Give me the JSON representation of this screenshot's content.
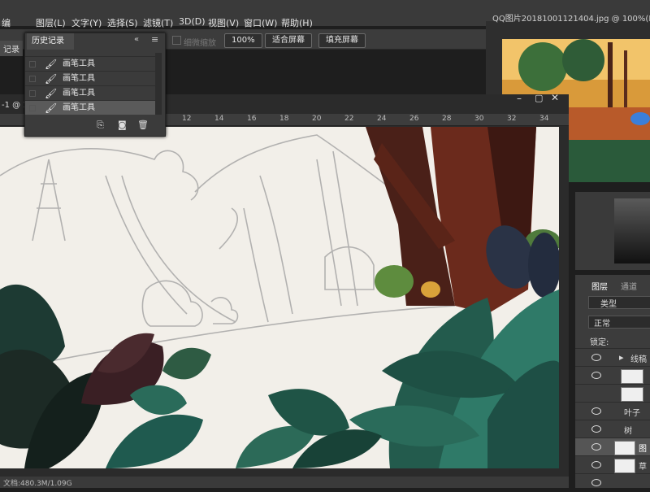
{
  "menubar": {
    "items": [
      "图层(L)",
      "文字(Y)",
      "选择(S)",
      "滤镜(T)",
      "3D(D)",
      "视图(V)",
      "窗口(W)",
      "帮助(H)"
    ],
    "partial_left": "编"
  },
  "options_bar": {
    "scrubby_zoom": "细微缩放",
    "zoom_value": "100%",
    "fit_screen": "适合屏幕",
    "fill_screen": "填充屏幕",
    "left_partial": "记录"
  },
  "history_panel": {
    "tab_label": "历史记录",
    "items": [
      "画笔工具",
      "画笔工具",
      "画笔工具",
      "画笔工具"
    ],
    "selected_index": 3
  },
  "document": {
    "tab_partial": "-1 @ 1",
    "ruler_ticks": [
      "12",
      "14",
      "16",
      "18",
      "20",
      "22",
      "24",
      "26",
      "28",
      "30",
      "32",
      "34"
    ],
    "status_partial": "文档:480.3M/1.09G"
  },
  "preview_window": {
    "title": "QQ图片20181001121404.jpg @ 100%(RGB/8..."
  },
  "layers_panel": {
    "tabs": [
      "图层",
      "通道"
    ],
    "kind_label": "类型",
    "blend_mode": "正常",
    "lock_label": "锁定:",
    "layers": [
      "线稿",
      "",
      "",
      "叶子",
      "树",
      "图",
      "草",
      ""
    ]
  },
  "colors": {
    "canvas": "#f2efe9",
    "panel": "#3b3b3b",
    "selected_row": "#5a5a5a",
    "dark_green": "#1e4f45",
    "teal": "#2f7a68",
    "tree_brown": "#5a2a1e",
    "dark_leaf": "#1c2a25"
  }
}
